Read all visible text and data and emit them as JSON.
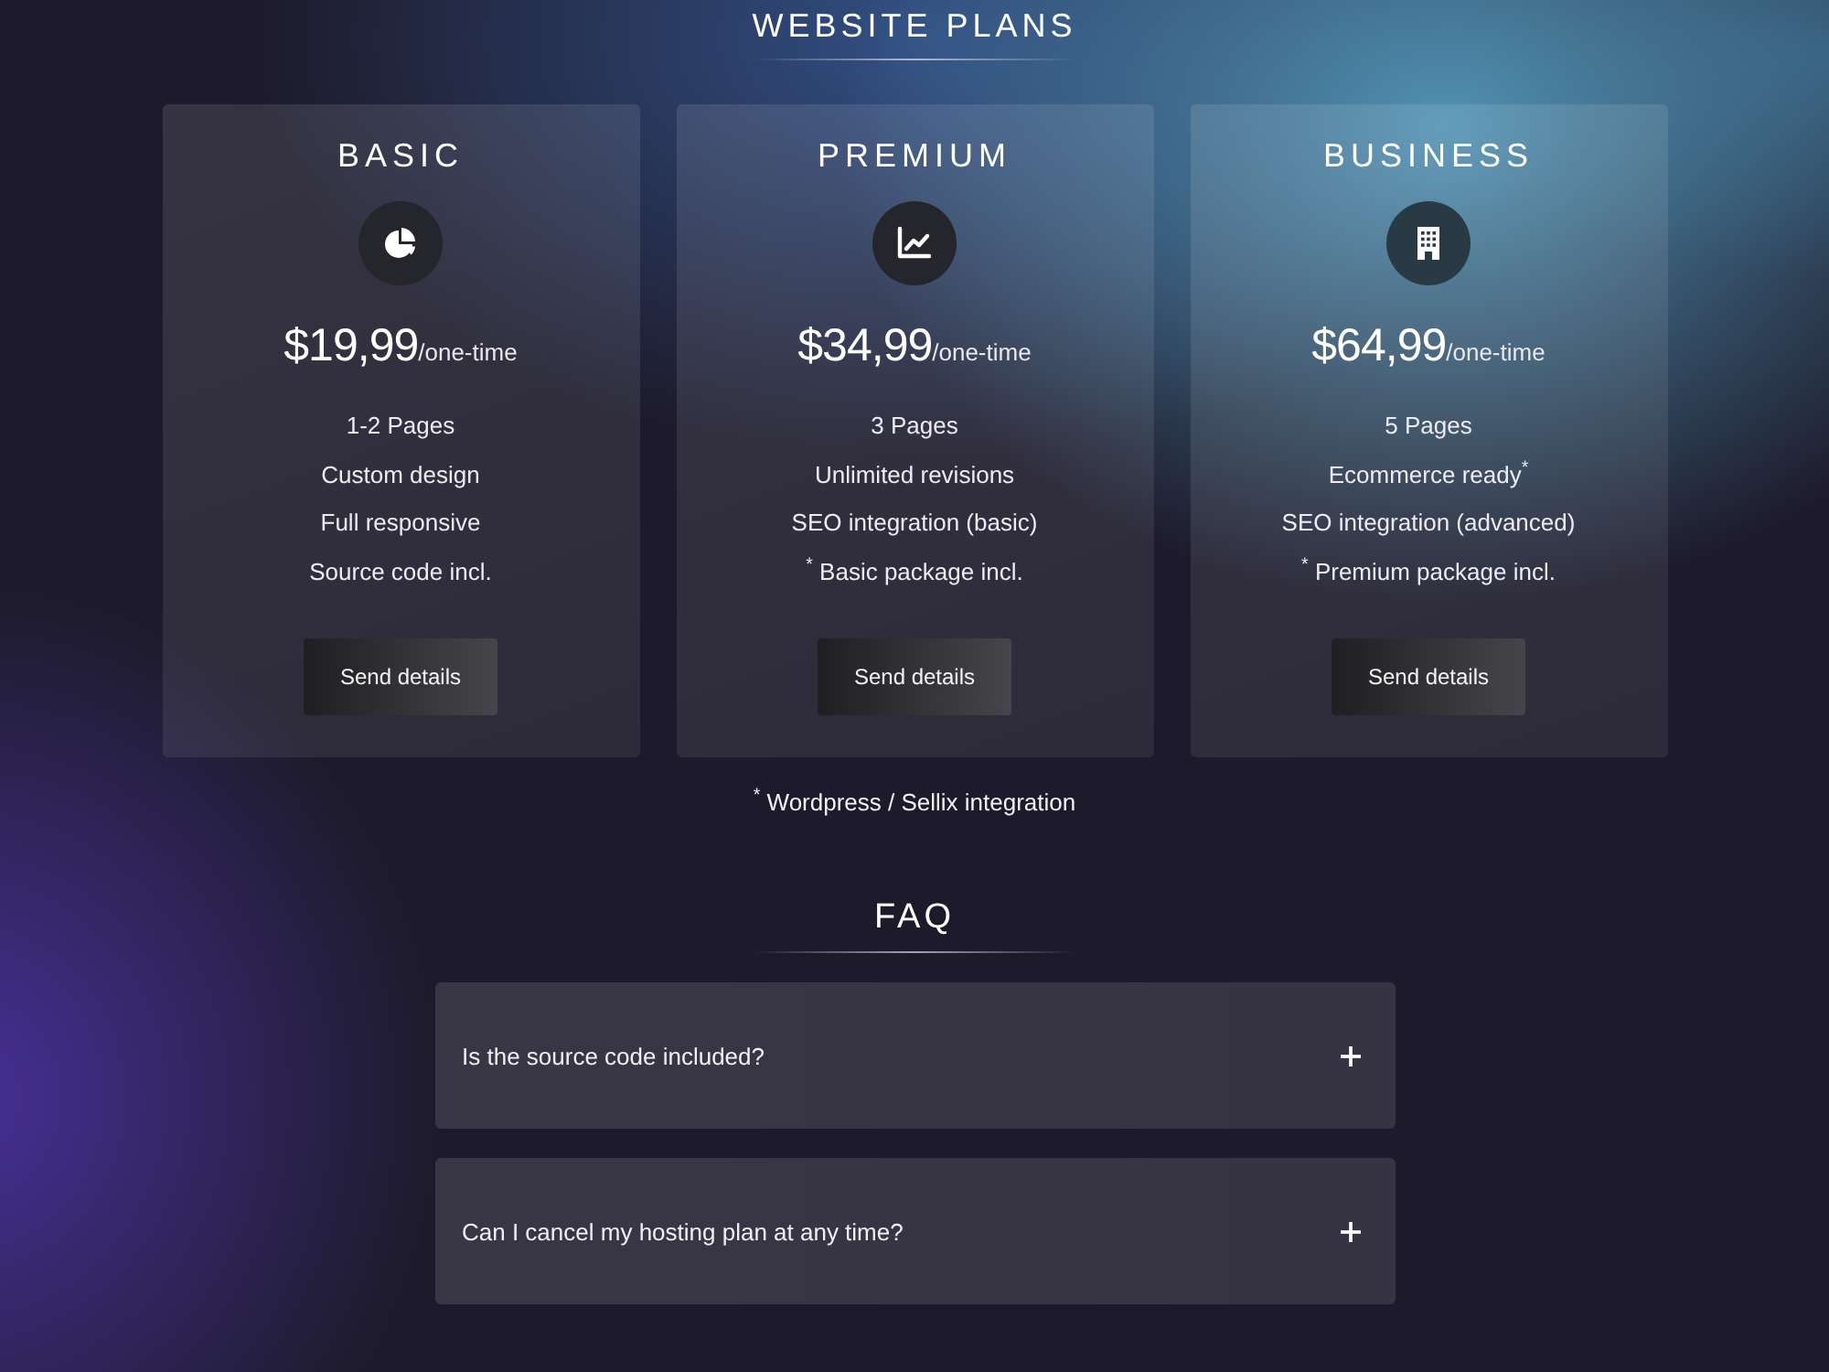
{
  "header": {
    "title": "WEBSITE PLANS"
  },
  "plans": [
    {
      "name": "BASIC",
      "price": "$19,99",
      "period": "/one-time",
      "features": [
        "1-2 Pages",
        "Custom design",
        "Full responsive",
        "Source code incl."
      ],
      "button": "Send details"
    },
    {
      "name": "PREMIUM",
      "price": "$34,99",
      "period": "/one-time",
      "features": [
        "3 Pages",
        "Unlimited revisions",
        "SEO integration (basic)",
        "$^{*}$ Basic package incl."
      ],
      "button": "Send details"
    },
    {
      "name": "BUSINESS",
      "price": "$64,99",
      "period": "/one-time",
      "features": [
        "5 Pages",
        "Ecommerce ready$^{*}$",
        "SEO integration (advanced)",
        "$^{*}$ Premium package incl."
      ],
      "button": "Send details"
    }
  ],
  "footnote": "$^{*}$ Wordpress / Sellix integration",
  "faq": {
    "title": "FAQ",
    "items": [
      {
        "question": "Is the source code included?",
        "expanded": false
      },
      {
        "question": "Can I cancel my hosting plan at any time?",
        "expanded": false
      }
    ]
  }
}
